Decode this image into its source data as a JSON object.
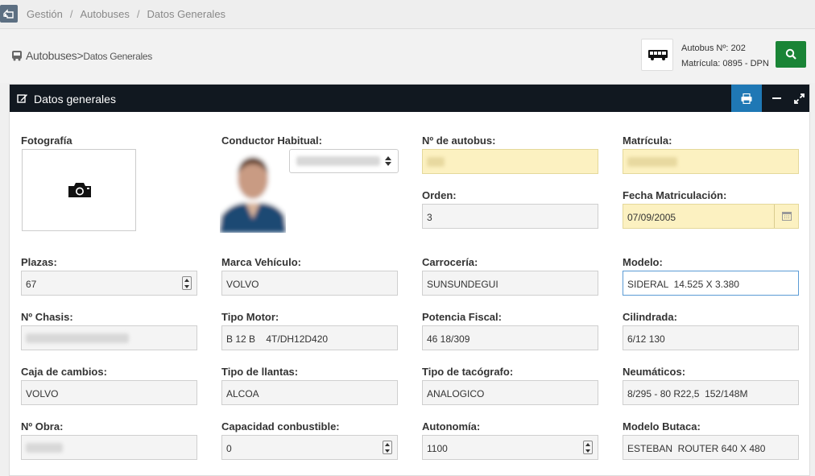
{
  "breadcrumb": {
    "items": [
      "Gestión",
      "Autobuses",
      "Datos Generales"
    ]
  },
  "page_title": {
    "section": "Autobuses",
    "sep": ">",
    "sub": "Datos Generales"
  },
  "bus_info": {
    "number": "Autobus Nº: 202",
    "plate": "Matrícula: 0895 - DPN"
  },
  "panel": {
    "title": "Datos generales"
  },
  "form": {
    "foto_label": "Fotografía",
    "conductor_label": "Conductor Habitual:",
    "num_autobus_label": "Nº de autobus:",
    "matricula_label": "Matrícula:",
    "orden_label": "Orden:",
    "orden_value": "3",
    "fecha_label": "Fecha Matriculación:",
    "fecha_value": "07/09/2005",
    "plazas_label": "Plazas:",
    "plazas_value": "67",
    "marca_label": "Marca Vehículo:",
    "marca_value": "VOLVO",
    "carroceria_label": "Carrocería:",
    "carroceria_value": "SUNSUNDEGUI",
    "modelo_label": "Modelo:",
    "modelo_value": "SIDERAL  14.525 X 3.380",
    "chasis_label": "Nº Chasis:",
    "motor_label": "Tipo Motor:",
    "motor_value": "B 12 B    4T/DH12D420",
    "potencia_label": "Potencia Fiscal:",
    "potencia_value": "46 18/309",
    "cilindrada_label": "Cilindrada:",
    "cilindrada_value": "6/12 130",
    "caja_label": "Caja de cambios:",
    "caja_value": "VOLVO",
    "llantas_label": "Tipo de llantas:",
    "llantas_value": "ALCOA",
    "tacografo_label": "Tipo de tacógrafo:",
    "tacografo_value": "ANALOGICO",
    "neumaticos_label": "Neumáticos:",
    "neumaticos_value": "8/295 - 80 R22,5  152/148M",
    "obra_label": "Nº Obra:",
    "capacidad_label": "Capacidad conbustible:",
    "capacidad_value": "0",
    "autonomia_label": "Autonomía:",
    "autonomia_value": "1100",
    "butaca_label": "Modelo Butaca:",
    "butaca_value": "ESTEBAN  ROUTER 640 X 480"
  },
  "colors": {
    "header_dark": "#111820",
    "print_blue": "#1f78b5",
    "search_green": "#1a8436",
    "highlight_yellow": "#fcf1c1"
  },
  "icons": [
    "home-icon",
    "bus-icon",
    "search-icon",
    "edit-icon",
    "print-icon",
    "minimize-icon",
    "expand-icon",
    "camera-icon",
    "calendar-icon"
  ]
}
